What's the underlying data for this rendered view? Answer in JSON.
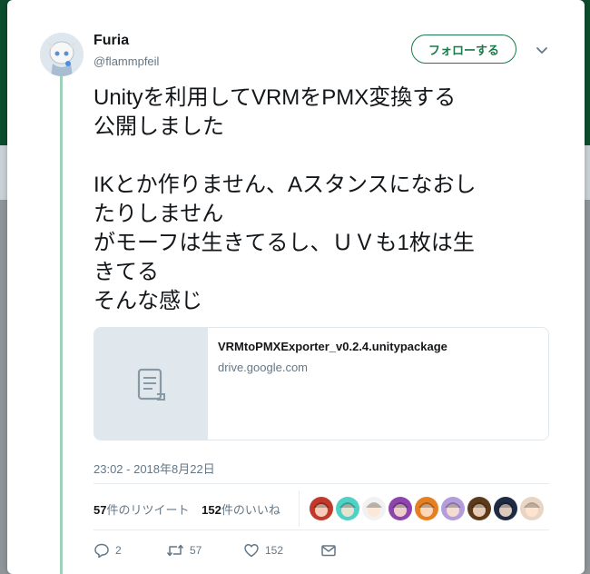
{
  "user": {
    "display_name": "Furia",
    "handle": "@flammpfeil",
    "follow_label": "フォローする"
  },
  "tweet": {
    "text": "Unityを利用してVRMをPMX変換する\n公開しました\n\nIKとか作りません、Aスタンスになおし\nたりしません\nがモーフは生きてるし、ＵＶも1枚は生\nきてる\nそんな感じ"
  },
  "link_card": {
    "title": "VRMtoPMXExporter_v0.2.4.unitypackage",
    "domain": "drive.google.com",
    "icon": "document-icon"
  },
  "timestamp": "23:02 - 2018年8月22日",
  "stats": {
    "retweet_count": "57",
    "retweet_suffix": "件のリツイート",
    "like_count": "152",
    "like_suffix": "件のいいね"
  },
  "liker_avatars": [
    {
      "name": "liker-avatar-1",
      "color": "#c0392b"
    },
    {
      "name": "liker-avatar-2",
      "color": "#4fd1c5"
    },
    {
      "name": "liker-avatar-3",
      "color": "#f2f2f2"
    },
    {
      "name": "liker-avatar-4",
      "color": "#8e44ad"
    },
    {
      "name": "liker-avatar-5",
      "color": "#e67e22"
    },
    {
      "name": "liker-avatar-6",
      "color": "#b39ddb"
    },
    {
      "name": "liker-avatar-7",
      "color": "#5d3a1a"
    },
    {
      "name": "liker-avatar-8",
      "color": "#1f2a44"
    },
    {
      "name": "liker-avatar-9",
      "color": "#e8d5c4"
    }
  ],
  "actions": {
    "reply_count": "2",
    "retweet_count": "57",
    "like_count": "152"
  },
  "colors": {
    "accent": "#1a7a4a",
    "thread_line": "#9fd1b9",
    "muted_text": "#657786"
  }
}
